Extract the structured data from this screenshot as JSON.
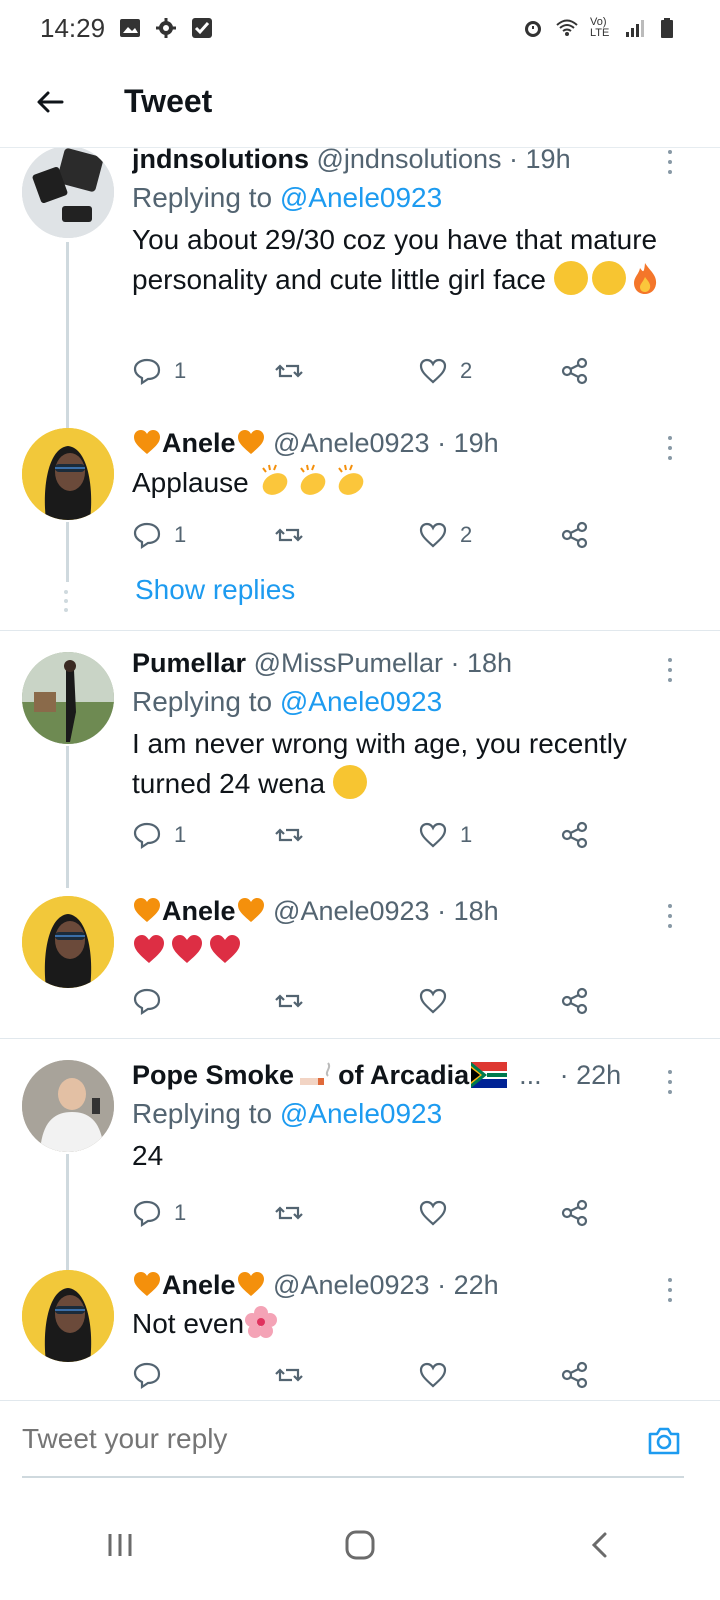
{
  "status_bar": {
    "time": "14:29",
    "network": "Vo) LTE"
  },
  "header": {
    "title": "Tweet"
  },
  "tweets": [
    {
      "name": "jndnsolutions",
      "handle": "@jndnsolutions",
      "time": "· 19h",
      "replying_label": "Replying to ",
      "replying_to": "@Anele0923",
      "text": "You about 29/30 coz you have that mature personality and cute little girl face",
      "reply_count": "1",
      "like_count": "2"
    },
    {
      "name": "Anele",
      "handle": "@Anele0923",
      "time": "· 19h",
      "text": "Applause",
      "reply_count": "1",
      "like_count": "2"
    },
    {
      "name": "Pumellar",
      "handle": "@MissPumellar",
      "time": "· 18h",
      "replying_label": "Replying to ",
      "replying_to": "@Anele0923",
      "text": "I am never wrong with age, you recently turned 24 wena",
      "reply_count": "1",
      "like_count": "1"
    },
    {
      "name": "Anele",
      "handle": "@Anele0923",
      "time": "· 18h",
      "text": "",
      "reply_count": "",
      "like_count": ""
    },
    {
      "name": "Pope Smoke",
      "name_suffix": "of Arcadia",
      "ellipsis": "...",
      "time": "· 22h",
      "replying_label": "Replying to ",
      "replying_to": "@Anele0923",
      "text": "24",
      "reply_count": "1",
      "like_count": ""
    },
    {
      "name": "Anele",
      "handle": "@Anele0923",
      "time": "· 22h",
      "text": "Not even",
      "reply_count": "",
      "like_count": ""
    }
  ],
  "show_replies": "Show replies",
  "reply_box": {
    "placeholder": "Tweet your reply"
  },
  "colors": {
    "accent": "#1d9bf0",
    "text": "#0f1419",
    "muted": "#536471",
    "divider": "#e1e8ed"
  },
  "icons": [
    "back-arrow-icon",
    "reply-icon",
    "retweet-icon",
    "like-icon",
    "share-icon",
    "more-icon",
    "camera-icon",
    "recents-icon",
    "home-icon",
    "back-nav-icon"
  ]
}
